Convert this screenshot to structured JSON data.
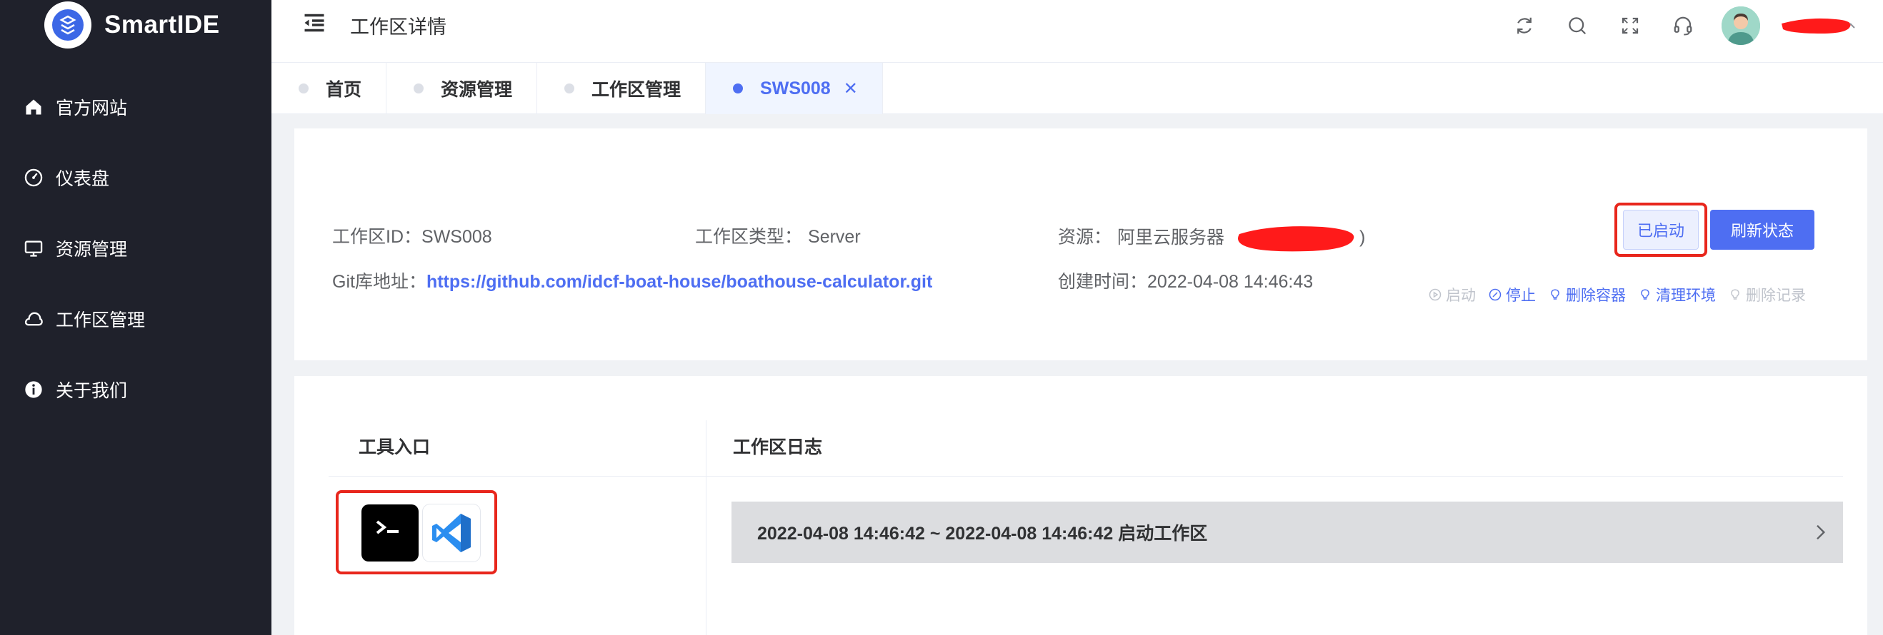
{
  "brand": {
    "name": "SmartIDE"
  },
  "sidebar": {
    "items": [
      {
        "label": "官方网站",
        "icon": "home-icon"
      },
      {
        "label": "仪表盘",
        "icon": "dashboard-icon"
      },
      {
        "label": "资源管理",
        "icon": "monitor-icon"
      },
      {
        "label": "工作区管理",
        "icon": "cloud-icon"
      },
      {
        "label": "关于我们",
        "icon": "info-icon"
      }
    ]
  },
  "header": {
    "title": "工作区详情",
    "icons": [
      "refresh-icon",
      "search-icon",
      "fullscreen-icon",
      "headset-icon"
    ]
  },
  "tabs": [
    {
      "label": "首页",
      "active": false
    },
    {
      "label": "资源管理",
      "active": false
    },
    {
      "label": "工作区管理",
      "active": false
    },
    {
      "label": "SWS008",
      "active": true
    }
  ],
  "workspace": {
    "id_label": "工作区ID：",
    "id_value": "SWS008",
    "type_label": "工作区类型：",
    "type_value": "Server",
    "resource_label": "资源：",
    "resource_value": "阿里云服务器",
    "resource_suffix": ")",
    "git_label": "Git库地址：",
    "git_url": "https://github.com/idcf-boat-house/boathouse-calculator.git",
    "created_label": "创建时间：",
    "created_value": "2022-04-08 14:46:43",
    "status_button": "已启动",
    "refresh_button": "刷新状态",
    "actions": {
      "start": "启动",
      "stop": "停止",
      "delete_container": "删除容器",
      "clean_env": "清理环境",
      "delete_record": "删除记录"
    }
  },
  "tools": {
    "heading": "工具入口"
  },
  "logs": {
    "heading": "工作区日志",
    "entries": [
      "2022-04-08 14:46:42 ~ 2022-04-08 14:46:42 启动工作区"
    ]
  },
  "colors": {
    "accent": "#4e6ef2",
    "sidebar_bg": "#1f212b",
    "highlight_red": "#e8261c"
  }
}
